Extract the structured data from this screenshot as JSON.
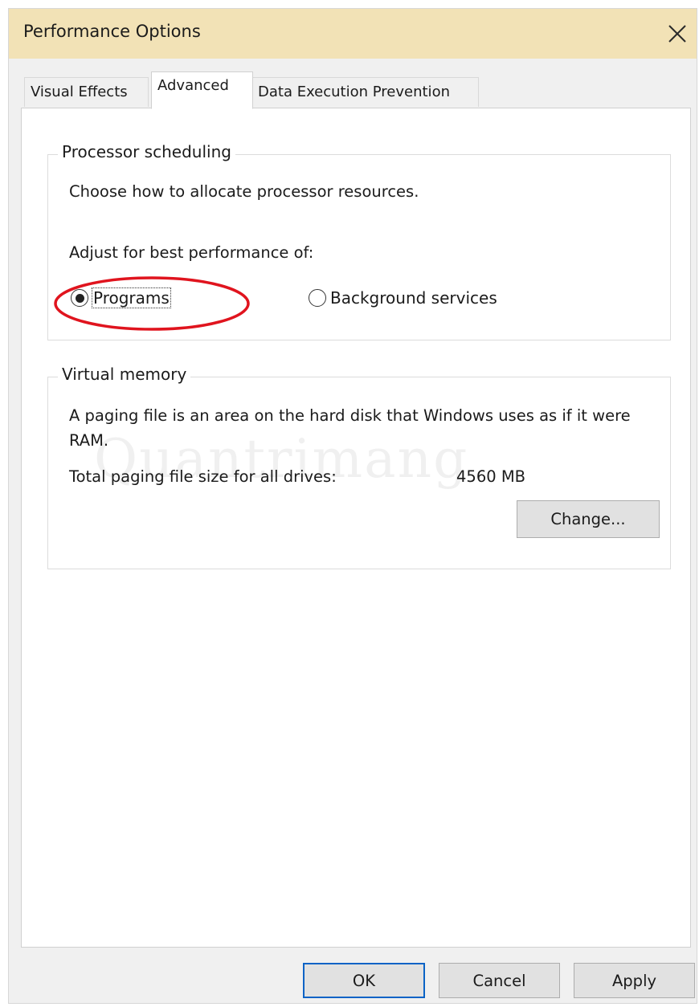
{
  "window": {
    "title": "Performance Options",
    "close_icon": "close-icon"
  },
  "tabs": [
    {
      "label": "Visual Effects",
      "active": false
    },
    {
      "label": "Advanced",
      "active": true
    },
    {
      "label": "Data Execution Prevention",
      "active": false
    }
  ],
  "processor_scheduling": {
    "legend": "Processor scheduling",
    "description": "Choose how to allocate processor resources.",
    "adjust_label": "Adjust for best performance of:",
    "options": [
      {
        "label": "Programs",
        "selected": true
      },
      {
        "label": "Background services",
        "selected": false
      }
    ],
    "highlight_color": "#e0141e"
  },
  "virtual_memory": {
    "legend": "Virtual memory",
    "description": "A paging file is an area on the hard disk that Windows uses as if it were RAM.",
    "total_label": "Total paging file size for all drives:",
    "total_value": "4560 MB",
    "change_button": "Change..."
  },
  "footer": {
    "ok": "OK",
    "cancel": "Cancel",
    "apply": "Apply"
  },
  "watermark": "Quantrimang",
  "colors": {
    "titlebar": "#f2e2b6",
    "ok_border": "#0a63c6"
  }
}
